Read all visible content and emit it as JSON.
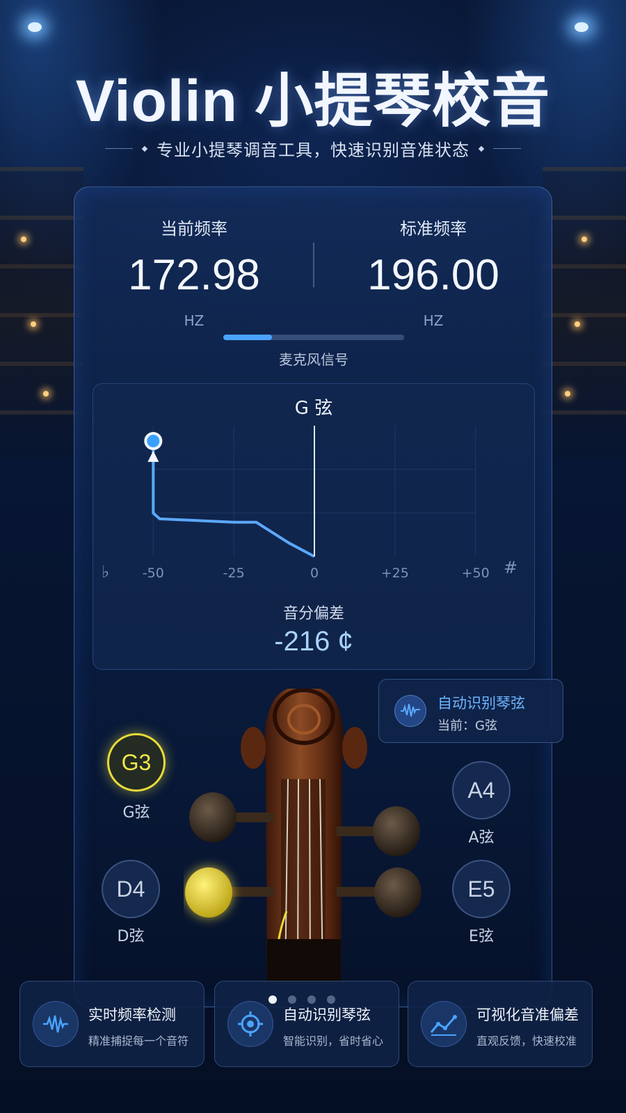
{
  "header": {
    "title": "Violin 小提琴校音",
    "subtitle": "专业小提琴调音工具，快速识别音准状态"
  },
  "frequency": {
    "current_label": "当前频率",
    "current_value": "172.98",
    "current_unit": "HZ",
    "standard_label": "标准频率",
    "standard_value": "196.00",
    "standard_unit": "HZ"
  },
  "microphone": {
    "label": "麦克风信号",
    "level": 0.27
  },
  "meter": {
    "string_title": "G 弦",
    "flat_symbol": "♭",
    "sharp_symbol": "#",
    "tick_labels": [
      "-50",
      "-25",
      "0",
      "+25",
      "+50"
    ],
    "deviation_label": "音分偏差",
    "deviation_value": "-216 ¢"
  },
  "chart_data": {
    "type": "line",
    "x": [
      -50,
      -50,
      -48,
      -40,
      -25,
      -18,
      -8,
      0
    ],
    "y": [
      1.0,
      0.38,
      0.33,
      0.32,
      0.3,
      0.3,
      0.12,
      0.0
    ],
    "xlabel": "",
    "ylabel": "",
    "xlim": [
      -60,
      60
    ],
    "tick_labels": [
      "-50",
      "-25",
      "0",
      "+25",
      "+50"
    ],
    "grid": true,
    "color": "#5ba8ff"
  },
  "auto_detect": {
    "title": "自动识别琴弦",
    "current": "当前：G弦",
    "icon": "waveform-icon"
  },
  "strings": [
    {
      "note": "G3",
      "label": "G弦",
      "active": true
    },
    {
      "note": "A4",
      "label": "A弦",
      "active": false
    },
    {
      "note": "D4",
      "label": "D弦",
      "active": false
    },
    {
      "note": "E5",
      "label": "E弦",
      "active": false
    }
  ],
  "features": [
    {
      "title": "实时频率检测",
      "desc": "精准捕捉每一个音符",
      "icon": "waveform-icon"
    },
    {
      "title": "自动识别琴弦",
      "desc": "智能识别，省时省心",
      "icon": "target-icon"
    },
    {
      "title": "可视化音准偏差",
      "desc": "直观反馈，快速校准",
      "icon": "trend-chart-icon"
    }
  ],
  "pager": {
    "count": 4,
    "active": 0
  },
  "colors": {
    "accent": "#4aa3ff",
    "active_string": "#e8dc3a",
    "background": "#071634"
  }
}
